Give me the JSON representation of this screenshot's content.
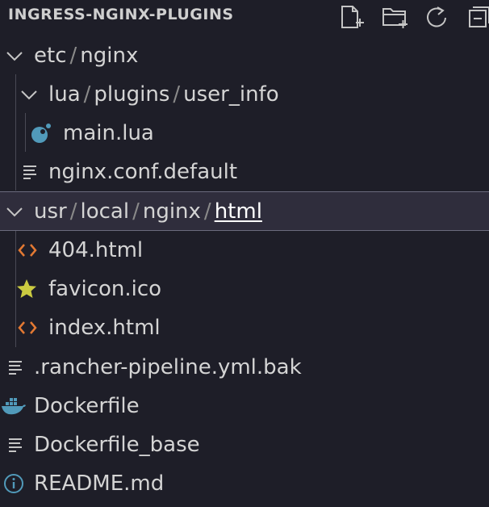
{
  "explorer": {
    "title": "INGRESS-NGINX-PLUGINS",
    "actions": {
      "new_file": "new-file-icon",
      "new_folder": "new-folder-icon",
      "refresh": "refresh-icon",
      "collapse": "collapse-all-icon"
    }
  },
  "tree": {
    "etc_nginx": {
      "segments": [
        "etc",
        "nginx"
      ]
    },
    "lua_plugins": {
      "segments": [
        "lua",
        "plugins",
        "user_info"
      ]
    },
    "main_lua": {
      "label": "main.lua"
    },
    "nginx_conf": {
      "label": "nginx.conf.default"
    },
    "usr_local": {
      "segments": [
        "usr",
        "local",
        "nginx",
        "html"
      ]
    },
    "file_404": {
      "label": "404.html"
    },
    "favicon": {
      "label": "favicon.ico"
    },
    "index_html": {
      "label": "index.html"
    },
    "rancher": {
      "label": ".rancher-pipeline.yml.bak"
    },
    "dockerfile": {
      "label": "Dockerfile"
    },
    "dockerfile_base": {
      "label": "Dockerfile_base"
    },
    "readme": {
      "label": "README.md"
    }
  },
  "colors": {
    "background": "#1e1e28",
    "selected_row": "#2f2d3c",
    "html_icon": "#e37933",
    "lua_icon": "#519aba",
    "star_icon": "#cbcb41",
    "docker_icon": "#519aba",
    "info_icon": "#519aba"
  }
}
